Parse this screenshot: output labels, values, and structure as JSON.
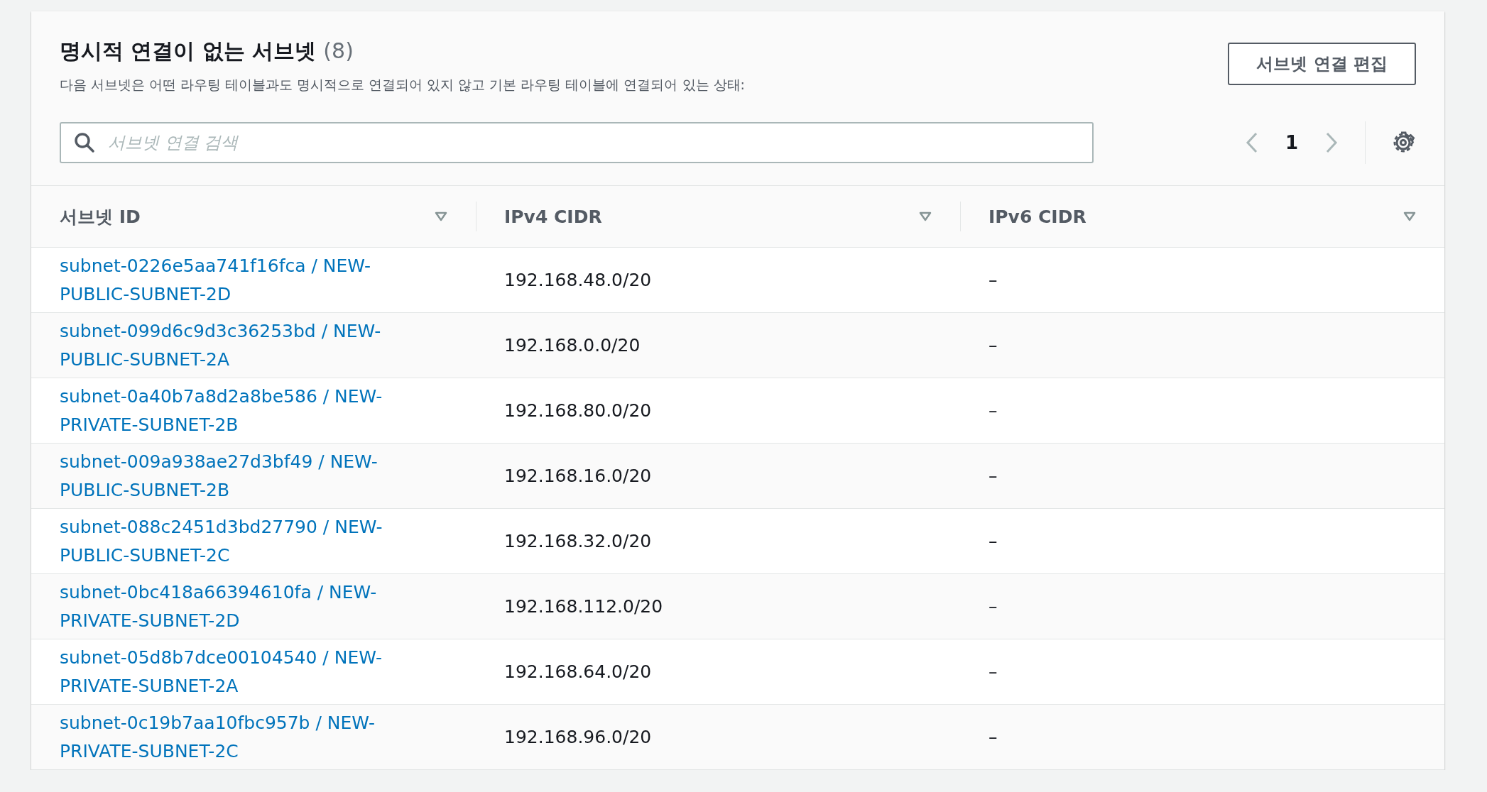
{
  "panel": {
    "title": "명시적 연결이 없는 서브넷",
    "count": "(8)",
    "description": "다음 서브넷은 어떤 라우팅 테이블과도 명시적으로 연결되어 있지 않고 기본 라우팅 테이블에 연결되어 있는 상태:",
    "edit_button": "서브넷 연결 편집"
  },
  "search": {
    "placeholder": "서브넷 연결 검색"
  },
  "pagination": {
    "page": "1"
  },
  "table": {
    "columns": [
      {
        "label": "서브넷 ID"
      },
      {
        "label": "IPv4 CIDR"
      },
      {
        "label": "IPv6 CIDR"
      }
    ],
    "rows": [
      {
        "subnet": "subnet-0226e5aa741f16fca / NEW-PUBLIC-SUBNET-2D",
        "ipv4": "192.168.48.0/20",
        "ipv6": "–"
      },
      {
        "subnet": "subnet-099d6c9d3c36253bd / NEW-PUBLIC-SUBNET-2A",
        "ipv4": "192.168.0.0/20",
        "ipv6": "–"
      },
      {
        "subnet": "subnet-0a40b7a8d2a8be586 / NEW-PRIVATE-SUBNET-2B",
        "ipv4": "192.168.80.0/20",
        "ipv6": "–"
      },
      {
        "subnet": "subnet-009a938ae27d3bf49 / NEW-PUBLIC-SUBNET-2B",
        "ipv4": "192.168.16.0/20",
        "ipv6": "–"
      },
      {
        "subnet": "subnet-088c2451d3bd27790 / NEW-PUBLIC-SUBNET-2C",
        "ipv4": "192.168.32.0/20",
        "ipv6": "–"
      },
      {
        "subnet": "subnet-0bc418a66394610fa / NEW-PRIVATE-SUBNET-2D",
        "ipv4": "192.168.112.0/20",
        "ipv6": "–"
      },
      {
        "subnet": "subnet-05d8b7dce00104540 / NEW-PRIVATE-SUBNET-2A",
        "ipv4": "192.168.64.0/20",
        "ipv6": "–"
      },
      {
        "subnet": "subnet-0c19b7aa10fbc957b / NEW-PRIVATE-SUBNET-2C",
        "ipv4": "192.168.96.0/20",
        "ipv6": "–"
      }
    ]
  }
}
